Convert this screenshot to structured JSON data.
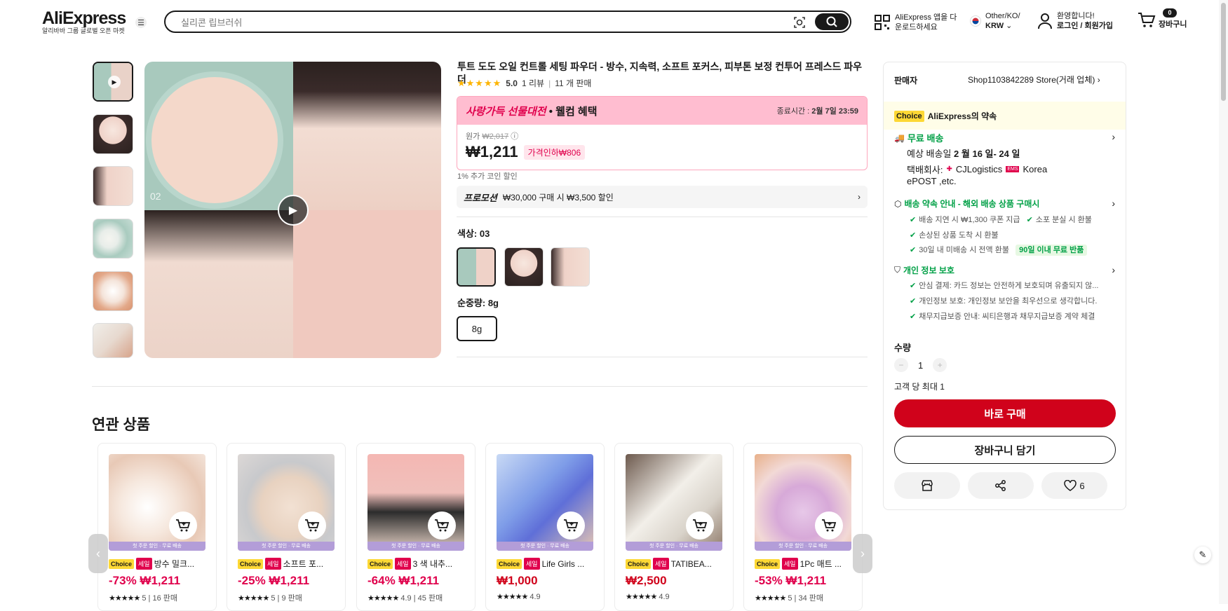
{
  "header": {
    "logo": "AliExpress",
    "logo_sub": "알리바바 그룹 글로벌 오픈 마켓",
    "search_placeholder": "실리콘 립브러쉬",
    "app_line1": "AliExpress 앱을 다",
    "app_line2": "운로드하세요",
    "region_line1": "Other/KO/",
    "region_line2": "KRW",
    "account_line1": "환영합니다!",
    "account_line2": "로그인 / 회원가입",
    "cart_count": "0",
    "cart_label": "장바구니"
  },
  "gallery": {
    "main_index_label": "02"
  },
  "product": {
    "title": "투트 도도 오일 컨트롤 세팅 파우더 - 방수, 지속력, 소프트 포커스, 피부톤 보정 컨투어 프레스드 파우더",
    "rating": "5.0",
    "reviews": "1 리뷰",
    "sold": "11 개 판매",
    "promo_brand": "사랑가득 선물대전",
    "promo_sub": "• 웰컴 혜택",
    "end_label": "종료시간 :",
    "end_time": "2월 7일 23:59",
    "orig_label": "원가",
    "orig_price": "₩2,017",
    "price": "₩1,211",
    "discount": "가격인하₩806",
    "coin": "1% 추가 코인 할인",
    "promotion_label": "프로모션",
    "promotion_text": "₩30,000 구매 시 ₩3,500 할인",
    "color_label": "색상: 03",
    "weight_label": "순중량: 8g",
    "weight_option": "8g"
  },
  "panel": {
    "seller_label": "판매자",
    "seller_name": "Shop1103842289 Store(거래 업체)",
    "choice_badge": "Choice",
    "promise": "AliExpress의 약속",
    "free_ship": "무료 배송",
    "eta_prefix": "예상 배송일",
    "eta": "2 월 16 일- 24 일",
    "carrier_label": "택배회사:",
    "carrier1": "CJLogistics",
    "carrier2": "Korea",
    "carrier3": "ePOST ,etc.",
    "guide": "배송 약속 안내 - 해외 배송 상품 구매시",
    "g1": "배송 지연 시 ₩1,300 쿠폰 지급",
    "g2": "소포 분실 시 환불",
    "g3": "손상된 상품 도착 시 환불",
    "g4": "30일 내 미배송 시 전액 환불",
    "g4_tag": "90일 이내 무료 반품",
    "privacy": "개인 정보 보호",
    "p1": "안심 결제: 카드 정보는 안전하게 보호되며 유출되지 않...",
    "p2": "개인정보 보호: 개인정보 보안을 최우선으로 생각합니다.",
    "p3": "채무지급보증 안내: 씨티은행과 채무지급보증 계약 체결",
    "qty_label": "수량",
    "qty": "1",
    "qty_limit": "고객 당 최대 1",
    "buy_now": "바로 구매",
    "add_cart": "장바구니 담기",
    "wish_count": "6"
  },
  "related": {
    "title": "연관 상품",
    "strip": "첫 주문 할인 · 무료 배송",
    "items": [
      {
        "choice": "Choice",
        "sale": "세일",
        "name": "방수 밀크...",
        "price": "-73% ₩1,211",
        "rating": "5",
        "sold": "16 판매"
      },
      {
        "choice": "Choice",
        "sale": "세일",
        "name": "소프트 포...",
        "price": "-25% ₩1,211",
        "rating": "5",
        "sold": "9 판매"
      },
      {
        "choice": "Choice",
        "sale": "세일",
        "name": "3 색 내추...",
        "price": "-64% ₩1,211",
        "rating": "4.9",
        "sold": "45 판매"
      },
      {
        "choice": "Choice",
        "sale": "세일",
        "name": "Life Girls ...",
        "price": "₩1,000",
        "rating": "4.9",
        "sold": ""
      },
      {
        "choice": "Choice",
        "sale": "세일",
        "name": "TATIBEA...",
        "price": "₩2,500",
        "rating": "4.9",
        "sold": ""
      },
      {
        "choice": "Choice",
        "sale": "세일",
        "name": "1Pc 매트 ...",
        "price": "-53% ₩1,211",
        "rating": "5",
        "sold": "34 판매"
      }
    ]
  },
  "colors": {
    "accent": "#d0021b",
    "choice": "#fdd835",
    "green": "#00a046",
    "pink": "#ffbdd0"
  }
}
